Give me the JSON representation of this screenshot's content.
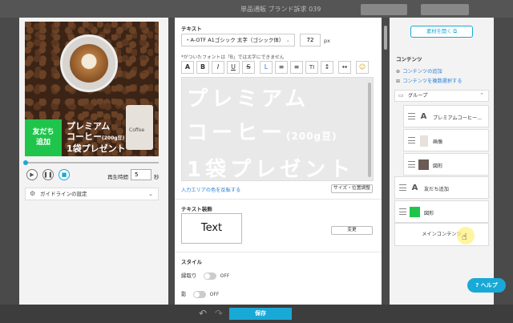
{
  "topbar": {
    "title": "単品通販 ブランド訴求 039"
  },
  "preview": {
    "green_label_line1": "友だち",
    "green_label_line2": "追加",
    "promo_line1": "プレミアム",
    "promo_line2_main": "コーヒー",
    "promo_line2_small": "(200g豆)",
    "promo_line3": "1袋プレゼント",
    "bag_label": "Coffee"
  },
  "player": {
    "progress": 0,
    "duration_label": "再生時間",
    "duration_value": "5",
    "duration_unit": "秒",
    "play_icon": "play-icon",
    "pause_icon": "pause-icon",
    "stop_icon": "stop-icon"
  },
  "guide": {
    "label": "ガイドラインの設定"
  },
  "text_panel": {
    "section_label": "テキスト",
    "font_value": "・A-OTF A1ゴシック 太字（ゴシック体）",
    "size_value": "72",
    "size_unit": "px",
    "note": "*がついたフォントは「B」では太字にできません",
    "toolbar_buttons": [
      "A",
      "B",
      "I",
      "U",
      "S",
      "L",
      "≡",
      "≡",
      "TI",
      "↕",
      "↔",
      "☺"
    ],
    "editor_lines": [
      "プレミアム",
      "コーヒー",
      "(200g豆)",
      "1袋プレゼント"
    ],
    "input_color_link": "入力エリアの色を反転する",
    "size_position_button": "サイズ・位置調整",
    "decoration_label": "テキスト装飾",
    "decoration_preview": "Text",
    "change_button": "変更",
    "style_label": "スタイル",
    "outline_label": "縁取り",
    "outline_state": "OFF",
    "shadow_label": "影",
    "shadow_state": "OFF"
  },
  "right_panel": {
    "material_button": "素材を開く",
    "contents_title": "コンテンツ",
    "add_content_link": "コンテンツの追加",
    "multi_select_link": "コンテンツを複数選択する",
    "group_label": "グループ",
    "group_items": [
      {
        "icon": "text-icon",
        "label": "プレミアムコーヒー..."
      },
      {
        "icon": "image-icon",
        "label": "画像"
      },
      {
        "icon": "shape-icon",
        "label": "図形",
        "color": "#6b5a55"
      }
    ],
    "items": [
      {
        "icon": "text-icon",
        "label": "友だち追加"
      },
      {
        "icon": "shape-icon",
        "label": "図形",
        "color": "#1fc54a"
      }
    ],
    "main_content": "メインコンテンツ"
  },
  "help_button": "ヘルプ",
  "save_button": "保存",
  "colors": {
    "accent": "#19a9d6",
    "green": "#1fc54a"
  }
}
